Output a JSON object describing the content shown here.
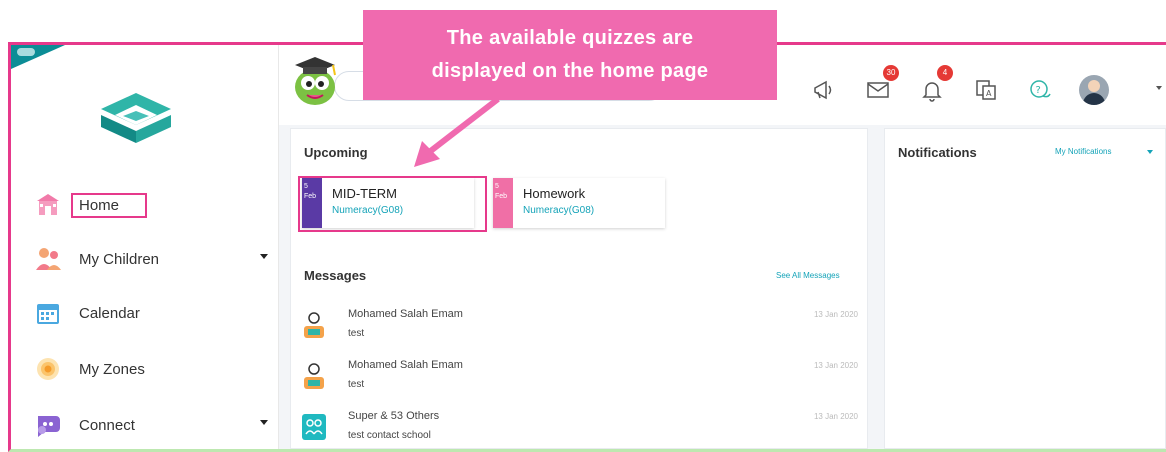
{
  "callout": {
    "line1": "The available quizzes are",
    "line2": "displayed on the home page"
  },
  "sidebar": {
    "items": [
      {
        "label": "Home",
        "icon": "school-icon"
      },
      {
        "label": "My Children",
        "icon": "children-icon"
      },
      {
        "label": "Calendar",
        "icon": "calendar-icon"
      },
      {
        "label": "My Zones",
        "icon": "zones-icon"
      },
      {
        "label": "Connect",
        "icon": "connect-icon"
      }
    ]
  },
  "header": {
    "messages_badge": "30",
    "notifications_badge": "4"
  },
  "upcoming": {
    "title": "Upcoming",
    "items": [
      {
        "day": "5",
        "month": "Feb",
        "title": "MID-TERM",
        "subject": "Numeracy(G08)",
        "color": "#5a3aa5"
      },
      {
        "day": "5",
        "month": "Feb",
        "title": "Homework",
        "subject": "Numeracy(G08)",
        "color": "#f06fa6"
      }
    ]
  },
  "messages": {
    "title": "Messages",
    "see_all": "See All Messages",
    "items": [
      {
        "name": "Mohamed Salah Emam",
        "text": "test",
        "date": "13 Jan 2020"
      },
      {
        "name": "Mohamed Salah Emam",
        "text": "test",
        "date": "13 Jan 2020"
      },
      {
        "name": "Super & 53 Others",
        "text": "test contact school",
        "date": "13 Jan 2020"
      }
    ]
  },
  "notifications": {
    "title": "Notifications",
    "filter": "My Notifications"
  },
  "colors": {
    "accent_pink": "#e6398b",
    "teal": "#14a3b8"
  }
}
